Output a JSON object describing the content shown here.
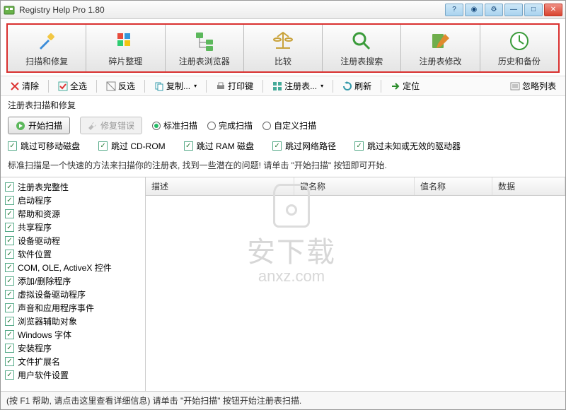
{
  "title": "Registry Help Pro 1.80",
  "toolbar": [
    {
      "label": "扫描和修复",
      "icon": "scan"
    },
    {
      "label": "碎片整理",
      "icon": "defrag"
    },
    {
      "label": "注册表浏览器",
      "icon": "browser"
    },
    {
      "label": "比较",
      "icon": "compare"
    },
    {
      "label": "注册表搜索",
      "icon": "search"
    },
    {
      "label": "注册表修改",
      "icon": "edit"
    },
    {
      "label": "历史和备份",
      "icon": "history"
    }
  ],
  "subtoolbar": {
    "clear": "清除",
    "selectall": "全选",
    "invert": "反选",
    "copy": "复制...",
    "printkey": "打印键",
    "registry": "注册表...",
    "refresh": "刷新",
    "locate": "定位",
    "ignore": "忽略列表"
  },
  "panel_title": "注册表扫描和修复",
  "scan": {
    "start": "开始扫描",
    "fix": "修复错误",
    "modes": {
      "standard": "标准扫描",
      "complete": "完成扫描",
      "custom": "自定义扫描"
    },
    "selected_mode": "standard"
  },
  "skip": {
    "removable": "跳过可移动磁盘",
    "cdrom": "跳过 CD-ROM",
    "ram": "跳过 RAM 磁盘",
    "network": "跳过网络路径",
    "unknown": "跳过未知或无效的驱动器"
  },
  "hint": "标准扫描是一个快速的方法来扫描你的注册表, 找到一些潜在的问题! 请单击 \"开始扫描\" 按钮即可开始.",
  "categories": [
    "注册表完整性",
    "启动程序",
    "帮助和资源",
    "共享程序",
    "设备驱动程",
    "软件位置",
    "COM, OLE, ActiveX 控件",
    "添加/删除程序",
    "虚拟设备驱动程序",
    "声音和应用程序事件",
    "浏览器辅助对象",
    "Windows 字体",
    "安装程序",
    "文件扩展名",
    "用户软件设置"
  ],
  "grid_headers": {
    "desc": "描述",
    "keyname": "键名称",
    "valuename": "值名称",
    "data": "数据"
  },
  "statusbar": "(按 F1 帮助, 请点击这里查看详细信息) 请单击 \"开始扫描\" 按钮开始注册表扫描.",
  "watermark": {
    "text": "安下载",
    "url": "anxz.com"
  }
}
